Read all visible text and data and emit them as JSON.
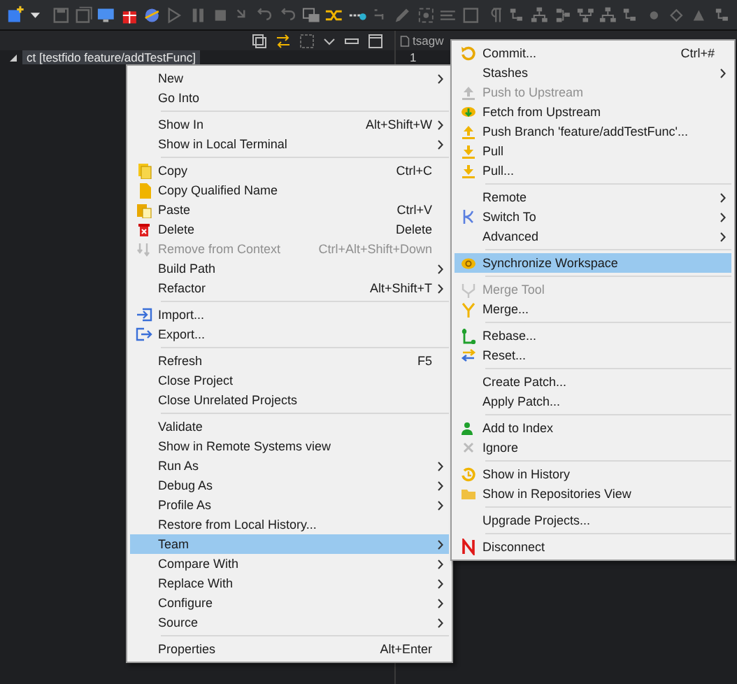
{
  "explorer": {
    "tree_row": "ct [testfido feature/addTestFunc]"
  },
  "editor": {
    "tab": "tsagw",
    "line_number": "1"
  },
  "context_menu": {
    "groups": [
      {
        "items": [
          {
            "label": "New",
            "submenu": true,
            "disabled": false,
            "selected": false
          },
          {
            "label": "Go Into",
            "submenu": false,
            "disabled": false,
            "selected": false
          }
        ]
      },
      {
        "items": [
          {
            "label": "Show In",
            "shortcut": "Alt+Shift+W",
            "submenu": true,
            "disabled": false,
            "selected": false
          },
          {
            "label": "Show in Local Terminal",
            "submenu": true,
            "disabled": false,
            "selected": false
          }
        ]
      },
      {
        "items": [
          {
            "label": "Copy",
            "shortcut": "Ctrl+C",
            "submenu": false,
            "disabled": false,
            "selected": false
          },
          {
            "label": "Copy Qualified Name",
            "submenu": false,
            "disabled": false,
            "selected": false
          },
          {
            "label": "Paste",
            "shortcut": "Ctrl+V",
            "submenu": false,
            "disabled": false,
            "selected": false
          },
          {
            "label": "Delete",
            "shortcut": "Delete",
            "submenu": false,
            "disabled": false,
            "selected": false
          },
          {
            "label": "Remove from Context",
            "shortcut": "Ctrl+Alt+Shift+Down",
            "submenu": false,
            "disabled": true,
            "selected": false
          },
          {
            "label": "Build Path",
            "submenu": true,
            "disabled": false,
            "selected": false
          },
          {
            "label": "Refactor",
            "shortcut": "Alt+Shift+T",
            "submenu": true,
            "disabled": false,
            "selected": false
          }
        ]
      },
      {
        "items": [
          {
            "label": "Import...",
            "submenu": false,
            "disabled": false,
            "selected": false
          },
          {
            "label": "Export...",
            "submenu": false,
            "disabled": false,
            "selected": false
          }
        ]
      },
      {
        "items": [
          {
            "label": "Refresh",
            "shortcut": "F5",
            "submenu": false,
            "disabled": false,
            "selected": false
          },
          {
            "label": "Close Project",
            "submenu": false,
            "disabled": false,
            "selected": false
          },
          {
            "label": "Close Unrelated Projects",
            "submenu": false,
            "disabled": false,
            "selected": false
          }
        ]
      },
      {
        "items": [
          {
            "label": "Validate",
            "submenu": false,
            "disabled": false,
            "selected": false
          },
          {
            "label": "Show in Remote Systems view",
            "submenu": false,
            "disabled": false,
            "selected": false
          },
          {
            "label": "Run As",
            "submenu": true,
            "disabled": false,
            "selected": false
          },
          {
            "label": "Debug As",
            "submenu": true,
            "disabled": false,
            "selected": false
          },
          {
            "label": "Profile As",
            "submenu": true,
            "disabled": false,
            "selected": false
          },
          {
            "label": "Restore from Local History...",
            "submenu": false,
            "disabled": false,
            "selected": false
          },
          {
            "label": "Team",
            "submenu": true,
            "disabled": false,
            "selected": true
          },
          {
            "label": "Compare With",
            "submenu": true,
            "disabled": false,
            "selected": false
          },
          {
            "label": "Replace With",
            "submenu": true,
            "disabled": false,
            "selected": false
          },
          {
            "label": "Configure",
            "submenu": true,
            "disabled": false,
            "selected": false
          },
          {
            "label": "Source",
            "submenu": true,
            "disabled": false,
            "selected": false
          }
        ]
      },
      {
        "items": [
          {
            "label": "Properties",
            "shortcut": "Alt+Enter",
            "submenu": false,
            "disabled": false,
            "selected": false
          }
        ]
      }
    ]
  },
  "team_submenu": {
    "groups": [
      {
        "items": [
          {
            "label": "Commit...",
            "shortcut": "Ctrl+#",
            "submenu": false,
            "disabled": false,
            "selected": false
          },
          {
            "label": "Stashes",
            "submenu": true,
            "disabled": false,
            "selected": false
          },
          {
            "label": "Push to Upstream",
            "submenu": false,
            "disabled": true,
            "selected": false
          },
          {
            "label": "Fetch from Upstream",
            "submenu": false,
            "disabled": false,
            "selected": false
          },
          {
            "label": "Push Branch 'feature/addTestFunc'...",
            "submenu": false,
            "disabled": false,
            "selected": false
          },
          {
            "label": "Pull",
            "submenu": false,
            "disabled": false,
            "selected": false
          },
          {
            "label": "Pull...",
            "submenu": false,
            "disabled": false,
            "selected": false
          }
        ]
      },
      {
        "items": [
          {
            "label": "Remote",
            "submenu": true,
            "disabled": false,
            "selected": false
          },
          {
            "label": "Switch To",
            "submenu": true,
            "disabled": false,
            "selected": false
          },
          {
            "label": "Advanced",
            "submenu": true,
            "disabled": false,
            "selected": false
          }
        ]
      },
      {
        "items": [
          {
            "label": "Synchronize Workspace",
            "submenu": false,
            "disabled": false,
            "selected": true
          }
        ]
      },
      {
        "items": [
          {
            "label": "Merge Tool",
            "submenu": false,
            "disabled": true,
            "selected": false
          },
          {
            "label": "Merge...",
            "submenu": false,
            "disabled": false,
            "selected": false
          }
        ]
      },
      {
        "items": [
          {
            "label": "Rebase...",
            "submenu": false,
            "disabled": false,
            "selected": false
          },
          {
            "label": "Reset...",
            "submenu": false,
            "disabled": false,
            "selected": false
          }
        ]
      },
      {
        "items": [
          {
            "label": "Create Patch...",
            "submenu": false,
            "disabled": false,
            "selected": false
          },
          {
            "label": "Apply Patch...",
            "submenu": false,
            "disabled": false,
            "selected": false
          }
        ]
      },
      {
        "items": [
          {
            "label": "Add to Index",
            "submenu": false,
            "disabled": false,
            "selected": false
          },
          {
            "label": "Ignore",
            "submenu": false,
            "disabled": false,
            "selected": false
          }
        ]
      },
      {
        "items": [
          {
            "label": "Show in History",
            "submenu": false,
            "disabled": false,
            "selected": false
          },
          {
            "label": "Show in Repositories View",
            "submenu": false,
            "disabled": false,
            "selected": false
          }
        ]
      },
      {
        "items": [
          {
            "label": "Upgrade Projects...",
            "submenu": false,
            "disabled": false,
            "selected": false
          }
        ]
      },
      {
        "items": [
          {
            "label": "Disconnect",
            "submenu": false,
            "disabled": false,
            "selected": false
          }
        ]
      }
    ]
  }
}
